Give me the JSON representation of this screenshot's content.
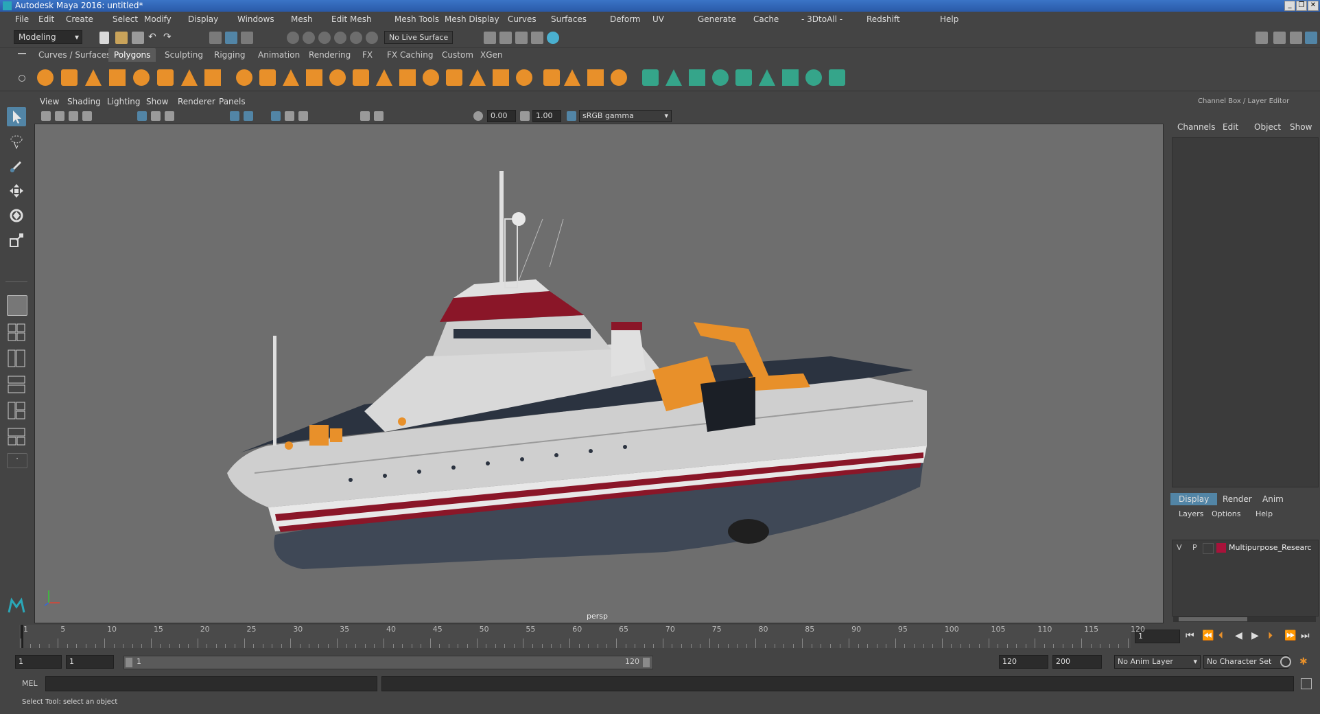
{
  "window": {
    "title": "Autodesk Maya 2016: untitled*"
  },
  "menubar": [
    "File",
    "Edit",
    "Create",
    "Select",
    "Modify",
    "Display",
    "Windows",
    "Mesh",
    "Edit Mesh",
    "Mesh Tools",
    "Mesh Display",
    "Curves",
    "Surfaces",
    "Deform",
    "UV",
    "Generate",
    "Cache",
    "- 3DtoAll -",
    "Redshift",
    "Help"
  ],
  "statusline": {
    "mode": "Modeling",
    "live_surface": "No Live Surface"
  },
  "shelf_tabs": [
    "Curves / Surfaces",
    "Polygons",
    "Sculpting",
    "Rigging",
    "Animation",
    "Rendering",
    "FX",
    "FX Caching",
    "Custom",
    "XGen"
  ],
  "shelf_active": "Polygons",
  "viewport": {
    "menus": [
      "View",
      "Shading",
      "Lighting",
      "Show",
      "Renderer",
      "Panels"
    ],
    "exposure": "0.00",
    "gamma": "1.00",
    "color_space": "sRGB gamma",
    "camera_label": "persp"
  },
  "channel_box": {
    "title": "Channel Box / Layer Editor",
    "menus": [
      "Channels",
      "Edit",
      "Object",
      "Show"
    ],
    "layer_tabs": [
      "Display",
      "Render",
      "Anim"
    ],
    "layer_menus": [
      "Layers",
      "Options",
      "Help"
    ],
    "layer": {
      "v": "V",
      "p": "P",
      "name": "Multipurpose_Researc",
      "color": "#a8123a"
    }
  },
  "timeline": {
    "ticks": [
      "1",
      "5",
      "10",
      "15",
      "20",
      "25",
      "30",
      "35",
      "40",
      "45",
      "50",
      "55",
      "60",
      "65",
      "70",
      "75",
      "80",
      "85",
      "90",
      "95",
      "100",
      "105",
      "110",
      "115",
      "120"
    ],
    "current_frame": "1"
  },
  "range": {
    "start": "1",
    "playback_start": "1",
    "slider_start": "1",
    "slider_end": "120",
    "playback_end": "120",
    "end": "200",
    "anim_layer": "No Anim Layer",
    "char_set": "No Character Set"
  },
  "cmd": {
    "label": "MEL"
  },
  "help_line": "Select Tool: select an object",
  "colors": {
    "bg": "#444444",
    "viewport": "#6e6e6e",
    "accent": "#5285a6",
    "orange": "#e8902a",
    "titlebar": "#2f64b4"
  }
}
